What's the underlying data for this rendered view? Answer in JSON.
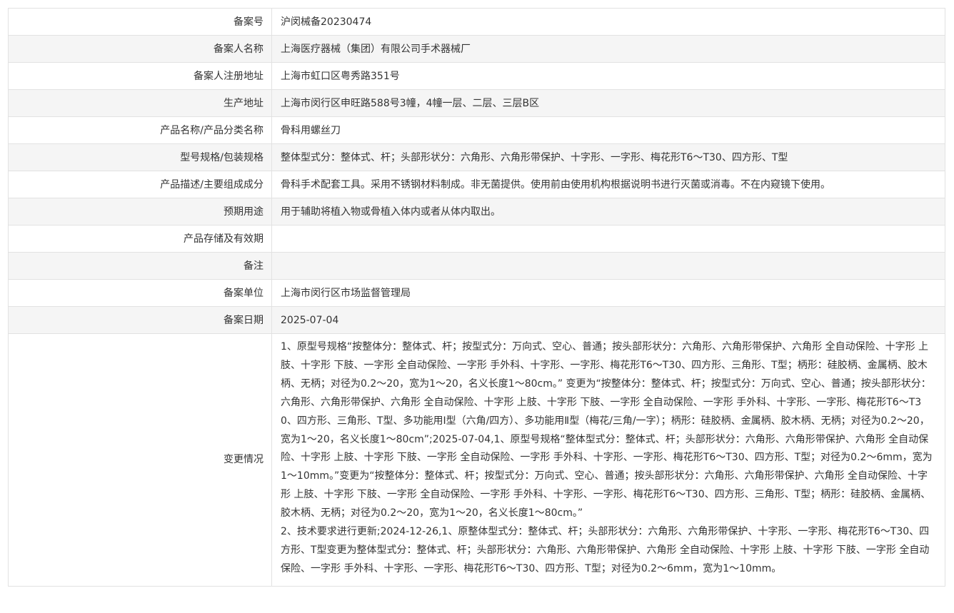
{
  "rows": [
    {
      "label": "备案号",
      "value": "沪闵械备20230474"
    },
    {
      "label": "备案人名称",
      "value": "上海医疗器械（集团）有限公司手术器械厂"
    },
    {
      "label": "备案人注册地址",
      "value": "上海市虹口区粤秀路351号"
    },
    {
      "label": "生产地址",
      "value": "上海市闵行区申旺路588号3幢，4幢一层、二层、三层B区"
    },
    {
      "label": "产品名称/产品分类名称",
      "value": "骨科用螺丝刀"
    },
    {
      "label": "型号规格/包装规格",
      "value": "整体型式分：整体式、杆；头部形状分：六角形、六角形带保护、十字形、一字形、梅花形T6～T30、四方形、T型"
    },
    {
      "label": "产品描述/主要组成成分",
      "value": "骨科手术配套工具。采用不锈钢材料制成。非无菌提供。使用前由使用机构根据说明书进行灭菌或消毒。不在内窥镜下使用。"
    },
    {
      "label": "预期用途",
      "value": "用于辅助将植入物或骨植入体内或者从体内取出。"
    },
    {
      "label": "产品存储及有效期",
      "value": ""
    },
    {
      "label": "备注",
      "value": ""
    },
    {
      "label": "备案单位",
      "value": "上海市闵行区市场监督管理局"
    },
    {
      "label": "备案日期",
      "value": "2025-07-04"
    }
  ],
  "change": {
    "label": "变更情况",
    "paragraphs": [
      "1、原型号规格“按整体分：整体式、杆；按型式分：万向式、空心、普通；按头部形状分：六角形、六角形带保护、六角形 全自动保险、十字形 上肢、十字形 下肢、一字形 全自动保险、一字形 手外科、十字形、一字形、梅花形T6～T30、四方形、三角形、T型；柄形：硅胶柄、金属柄、胶木柄、无柄；对径为0.2～20，宽为1～20，名义长度1～80cm。” 变更为“按整体分：整体式、杆；按型式分：万向式、空心、普通；按头部形状分：六角形、六角形带保护、六角形 全自动保险、十字形 上肢、十字形 下肢、一字形 全自动保险、一字形 手外科、十字形、一字形、梅花形T6～T30、四方形、三角形、T型、多功能用Ⅰ型（六角/四方）、多功能用Ⅱ型（梅花/三角/一字）；柄形：硅胶柄、金属柄、胶木柄、无柄；对径为0.2～20，宽为1～20，名义长度1～80cm”;2025-07-04,1、原型号规格“整体型式分：整体式、杆；头部形状分：六角形、六角形带保护、六角形 全自动保险、十字形 上肢、十字形 下肢、一字形 全自动保险、一字形 手外科、十字形、一字形、梅花形T6～T30、四方形、T型；对径为0.2～6mm，宽为1～10mm。”变更为“按整体分：整体式、杆；按型式分：万向式、空心、普通；按头部形状分：六角形、六角形带保护、六角形 全自动保险、十字形 上肢、十字形 下肢、一字形 全自动保险、一字形 手外科、十字形、一字形、梅花形T6～T30、四方形、三角形、T型；柄形：硅胶柄、金属柄、胶木柄、无柄；对径为0.2～20，宽为1～20，名义长度1～80cm。”",
      "2、技术要求进行更新;2024-12-26,1、原整体型式分：整体式、杆；头部形状分：六角形、六角形带保护、十字形、一字形、梅花形T6～T30、四方形、T型变更为整体型式分：整体式、杆；头部形状分：六角形、六角形带保护、六角形 全自动保险、十字形 上肢、十字形 下肢、一字形 全自动保险、一字形 手外科、十字形、一字形、梅花形T6～T30、四方形、T型；对径为0.2～6mm，宽为1～10mm。"
    ]
  }
}
